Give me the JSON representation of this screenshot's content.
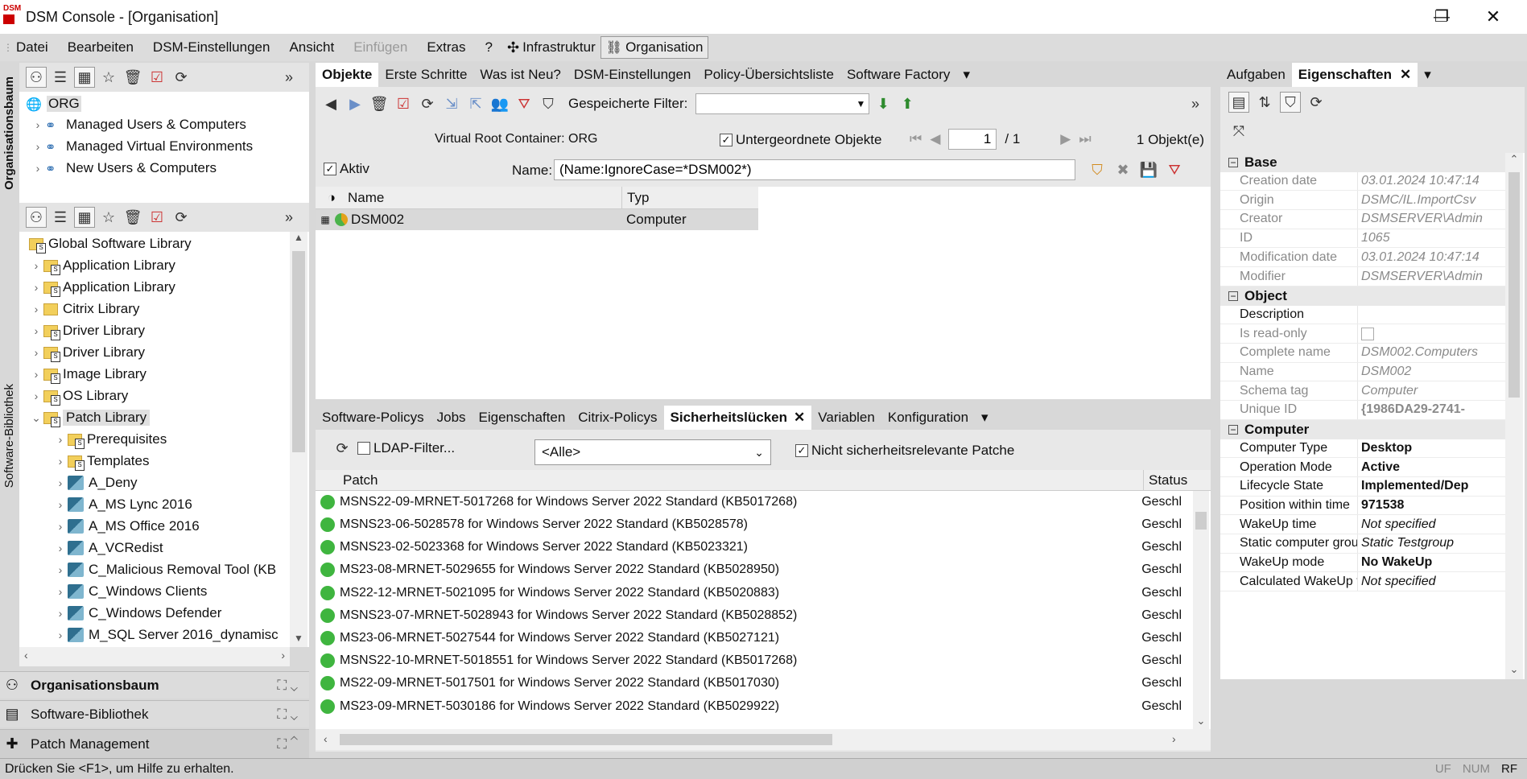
{
  "window": {
    "title": "DSM Console - [Organisation]",
    "logo_text": "DSM",
    "minimize": "—",
    "maximize": "❐",
    "close": "✕"
  },
  "menu": {
    "items": [
      "Datei",
      "Bearbeiten",
      "DSM-Einstellungen",
      "Ansicht",
      "Einfügen",
      "Extras",
      "?"
    ],
    "infrastruktur": "Infrastruktur",
    "organisation": "Organisation"
  },
  "side_labels": {
    "org": "Organisationsbaum",
    "sw": "Software-Bibliothek"
  },
  "org_tree": {
    "root": "ORG",
    "items": [
      "Managed Users & Computers",
      "Managed Virtual Environments",
      "New Users & Computers"
    ]
  },
  "sw_tree": {
    "root": "Global Software Library",
    "items": [
      "Application Library",
      "Application Library",
      "Citrix Library",
      "Driver Library",
      "Driver Library",
      "Image Library",
      "OS Library",
      "Patch Library"
    ],
    "children": [
      "Prerequisites",
      "Templates",
      "A_Deny",
      "A_MS Lync 2016",
      "A_MS Office 2016",
      "A_VCRedist",
      "C_Malicious Removal Tool (KB",
      "C_Windows Clients",
      "C_Windows Defender",
      "M_SQL Server 2016_dynamisc"
    ]
  },
  "bottom_nav": {
    "org": "Organisationsbaum",
    "sw": "Software-Bibliothek",
    "patch": "Patch Management"
  },
  "status_bar": {
    "help": "Drücken Sie <F1>, um Hilfe zu erhalten.",
    "uf": "UF",
    "num": "NUM",
    "rf": "RF"
  },
  "main_tabs": [
    "Objekte",
    "Erste Schritte",
    "Was ist Neu?",
    "DSM-Einstellungen",
    "Policy-Übersichtsliste",
    "Software Factory"
  ],
  "objects": {
    "saved_filter_label": "Gespeicherte Filter:",
    "saved_filter_value": "",
    "virtual_root": "Virtual Root Container: ORG",
    "sub_objects": "Untergeordnete Objekte",
    "page": "1",
    "page_total": "/ 1",
    "count": "1 Objekt(e)",
    "aktiv": "Aktiv",
    "name_label": "Name:",
    "name_filter": "(Name:IgnoreCase=*DSM002*)",
    "col_name": "Name",
    "col_typ": "Typ",
    "row_name": "DSM002",
    "row_typ": "Computer"
  },
  "detail_tabs": [
    "Software-Policys",
    "Jobs",
    "Eigenschaften",
    "Citrix-Policys",
    "Sicherheitslücken",
    "Variablen",
    "Konfiguration"
  ],
  "patches": {
    "ldap": "LDAP-Filter...",
    "select": "<Alle>",
    "non_security": "Nicht sicherheitsrelevante Patche",
    "col_patch": "Patch",
    "col_status": "Status",
    "rows": [
      {
        "name": "MSNS22-09-MRNET-5017268 for Windows Server 2022 Standard (KB5017268)",
        "status": "Geschl"
      },
      {
        "name": "MSNS23-06-5028578 for Windows Server 2022 Standard (KB5028578)",
        "status": "Geschl"
      },
      {
        "name": "MSNS23-02-5023368 for Windows Server 2022 Standard (KB5023321)",
        "status": "Geschl"
      },
      {
        "name": "MS23-08-MRNET-5029655 for Windows Server 2022 Standard (KB5028950)",
        "status": "Geschl"
      },
      {
        "name": "MS22-12-MRNET-5021095 for Windows Server 2022 Standard (KB5020883)",
        "status": "Geschl"
      },
      {
        "name": "MSNS23-07-MRNET-5028943 for Windows Server 2022 Standard (KB5028852)",
        "status": "Geschl"
      },
      {
        "name": "MS23-06-MRNET-5027544 for Windows Server 2022 Standard (KB5027121)",
        "status": "Geschl"
      },
      {
        "name": "MSNS22-10-MRNET-5018551 for Windows Server 2022 Standard (KB5017268)",
        "status": "Geschl"
      },
      {
        "name": "MS22-09-MRNET-5017501 for Windows Server 2022 Standard (KB5017030)",
        "status": "Geschl"
      },
      {
        "name": "MS23-09-MRNET-5030186 for Windows Server 2022 Standard (KB5029922)",
        "status": "Geschl"
      }
    ]
  },
  "right_tabs": {
    "aufgaben": "Aufgaben",
    "eigenschaften": "Eigenschaften"
  },
  "properties": {
    "base": {
      "title": "Base",
      "rows": [
        {
          "k": "Creation date",
          "v": "03.01.2024 10:47:14"
        },
        {
          "k": "Origin",
          "v": "DSMC/IL.ImportCsv"
        },
        {
          "k": "Creator",
          "v": "DSMSERVER\\Admin"
        },
        {
          "k": "ID",
          "v": "1065"
        },
        {
          "k": "Modification date",
          "v": "03.01.2024 10:47:14"
        },
        {
          "k": "Modifier",
          "v": "DSMSERVER\\Admin"
        }
      ]
    },
    "object": {
      "title": "Object",
      "rows": [
        {
          "k": "Description",
          "v": ""
        },
        {
          "k": "Is read-only",
          "v": ""
        },
        {
          "k": "Complete name",
          "v": "DSM002.Computers"
        },
        {
          "k": "Name",
          "v": "DSM002"
        },
        {
          "k": "Schema tag",
          "v": "Computer"
        },
        {
          "k": "Unique ID",
          "v": "{1986DA29-2741-"
        }
      ]
    },
    "computer": {
      "title": "Computer",
      "rows": [
        {
          "k": "Computer Type",
          "v": "Desktop"
        },
        {
          "k": "Operation Mode",
          "v": "Active"
        },
        {
          "k": "Lifecycle State",
          "v": "Implemented/Dep"
        },
        {
          "k": "Position within time",
          "v": "971538"
        },
        {
          "k": "WakeUp time",
          "v": "Not specified"
        },
        {
          "k": "Static computer grou",
          "v": "Static Testgroup"
        },
        {
          "k": "WakeUp mode",
          "v": "No WakeUp"
        },
        {
          "k": "Calculated WakeUp t",
          "v": "Not specified"
        }
      ]
    }
  }
}
